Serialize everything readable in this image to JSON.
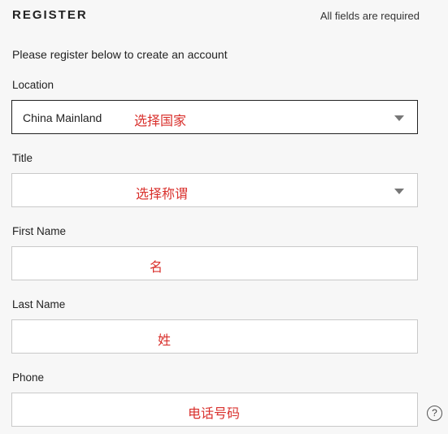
{
  "form": {
    "title": "REGISTER",
    "required_note": "All fields are required",
    "intro": "Please register below to create an account"
  },
  "fields": {
    "location": {
      "label": "Location",
      "value": "China Mainland",
      "annotation": "选择国家"
    },
    "title": {
      "label": "Title",
      "value": "",
      "annotation": "选择称谓"
    },
    "first_name": {
      "label": "First Name",
      "value": "",
      "annotation": "名"
    },
    "last_name": {
      "label": "Last Name",
      "value": "",
      "annotation": "姓"
    },
    "phone": {
      "label": "Phone",
      "value": "",
      "annotation": "电话号码",
      "help": "?"
    }
  },
  "icons": {
    "dropdown": "chevron-down-icon",
    "help": "help-icon"
  },
  "colors": {
    "annotation": "#d9302c",
    "border": "#c9c9c9",
    "focus_border": "#222222"
  }
}
